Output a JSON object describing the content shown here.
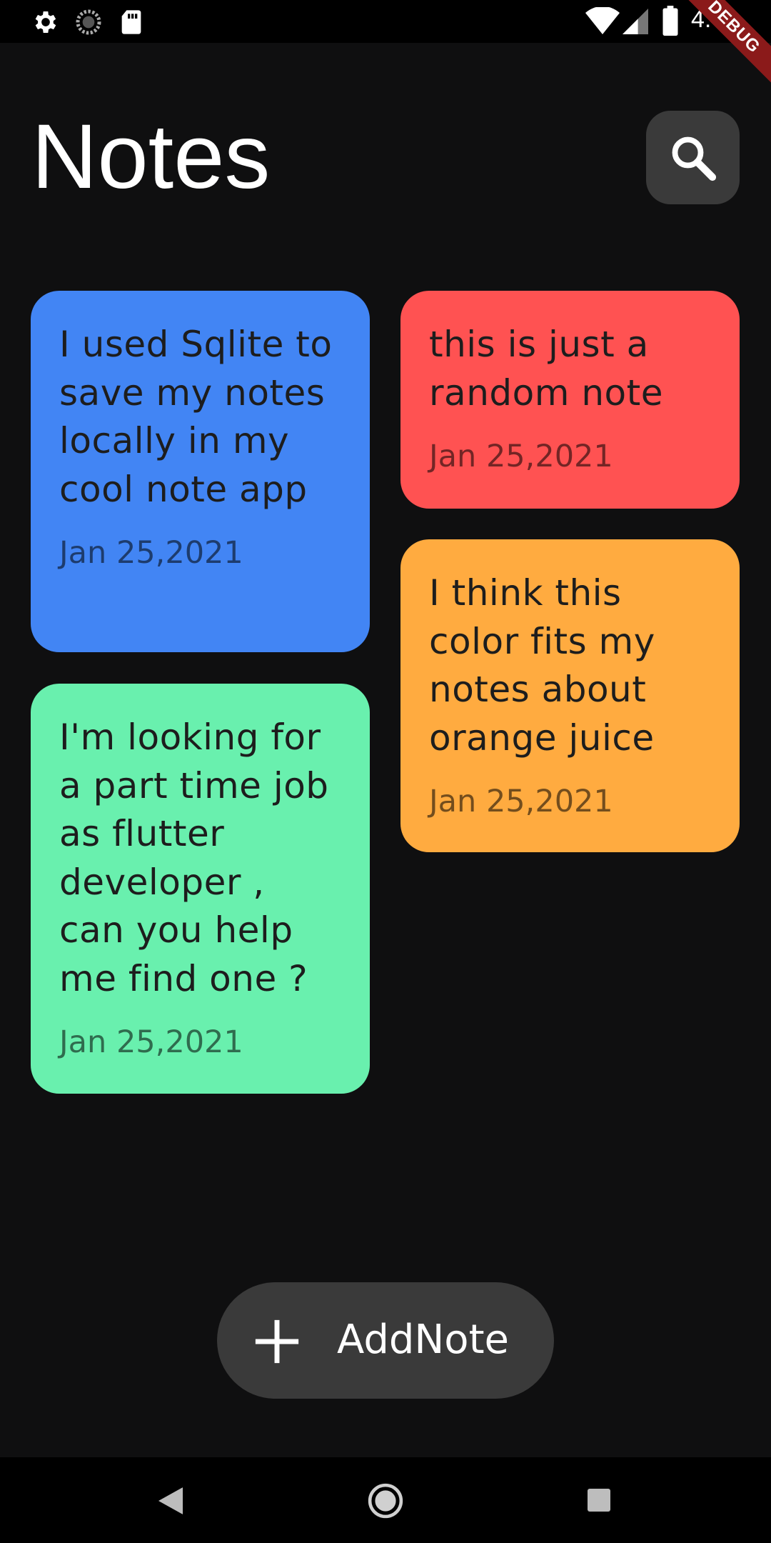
{
  "status_bar": {
    "time": "4:49",
    "icons": [
      "settings-icon",
      "sync-icon",
      "sd-card-icon",
      "wifi-icon",
      "signal-icon",
      "battery-icon"
    ]
  },
  "debug_banner": "DEBUG",
  "header": {
    "title": "Notes",
    "search_icon": "search-icon"
  },
  "notes": [
    {
      "text": "I used Sqlite to save my notes locally in my cool note app",
      "date": "Jan 25,2021",
      "color": "#4285f4"
    },
    {
      "text": "this is just a random note",
      "date": "Jan 25,2021",
      "color": "#ff5252"
    },
    {
      "text": "I think this color fits my notes about orange juice",
      "date": "Jan 25,2021",
      "color": "#ffab40"
    },
    {
      "text": "I'm looking for a part time job as flutter developer , can you help me find one ?",
      "date": "Jan 25,2021",
      "color": "#69f0ae"
    }
  ],
  "add_button": {
    "label": "AddNote",
    "icon": "plus-icon"
  },
  "nav_bar": {
    "icons": [
      "back-icon",
      "home-icon",
      "recents-icon"
    ]
  }
}
